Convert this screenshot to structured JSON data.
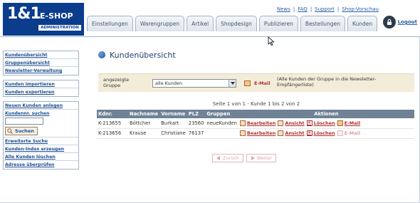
{
  "logo": {
    "brand": "1&1",
    "product": "E-SHOP",
    "subtitle": "ADMINISTRATION"
  },
  "top_links": [
    "News",
    "FAQ",
    "Support",
    "Shop-Vorschau"
  ],
  "tabs": [
    "Einstellungen",
    "Warengruppen",
    "Artikel",
    "Shopdesign",
    "Publizieren",
    "Bestellungen",
    "Kunden"
  ],
  "logout": {
    "label": "Logout"
  },
  "sidebar": {
    "group1": [
      "Kundenübersicht",
      "Gruppenübersicht",
      "Newsletter-Verwaltung"
    ],
    "group2": [
      "Kunden importieren",
      "Kunden exportieren"
    ],
    "group3": {
      "new_customer": "Neuen Kunden anlegen",
      "search_label": "Kundennr. suchen",
      "search_value": "",
      "search_button": "Suchen",
      "extended_search": "Erweiterte Suche",
      "create_index": "Kunden-Index erzeugen",
      "delete_all": "Alle Kunden löschen",
      "check_address": "Adresse überprüfen"
    }
  },
  "main": {
    "title": "Kundenübersicht",
    "filter": {
      "label": "angezeigte Gruppe",
      "selected": "alle Kunden",
      "email_label": "E-Mail",
      "hint": "(Alle Kunden der Gruppe in die Newsletter-Empfängerliste)"
    },
    "pagination_info": "Seite 1 von 1 - Kunde 1 bis 2 von 2",
    "table": {
      "headers": [
        "Kdnr.",
        "Nachname",
        "Vorname",
        "PLZ",
        "Gruppen",
        "Aktionen"
      ],
      "action_labels": {
        "edit": "Bearbeiten",
        "view": "Ansicht",
        "delete": "Löschen",
        "email": "E-Mail"
      },
      "rows": [
        {
          "kdnr": "K-213655",
          "nachname": "Böttcher",
          "vorname": "Burkart",
          "plz": "23560",
          "gruppen": "neueKunden",
          "email_enabled": true
        },
        {
          "kdnr": "K-213656",
          "nachname": "Krause",
          "vorname": "Christiane",
          "plz": "76137",
          "gruppen": "",
          "email_enabled": false
        }
      ]
    },
    "pager": {
      "back": "Zurück",
      "next": "Weiter"
    }
  },
  "colors": {
    "logo_blue": "#0b3d8c",
    "link_blue": "#1f4f8f",
    "action_red": "#b03030",
    "table_header": "#6f8296",
    "filter_bg": "#f3ecd9"
  }
}
